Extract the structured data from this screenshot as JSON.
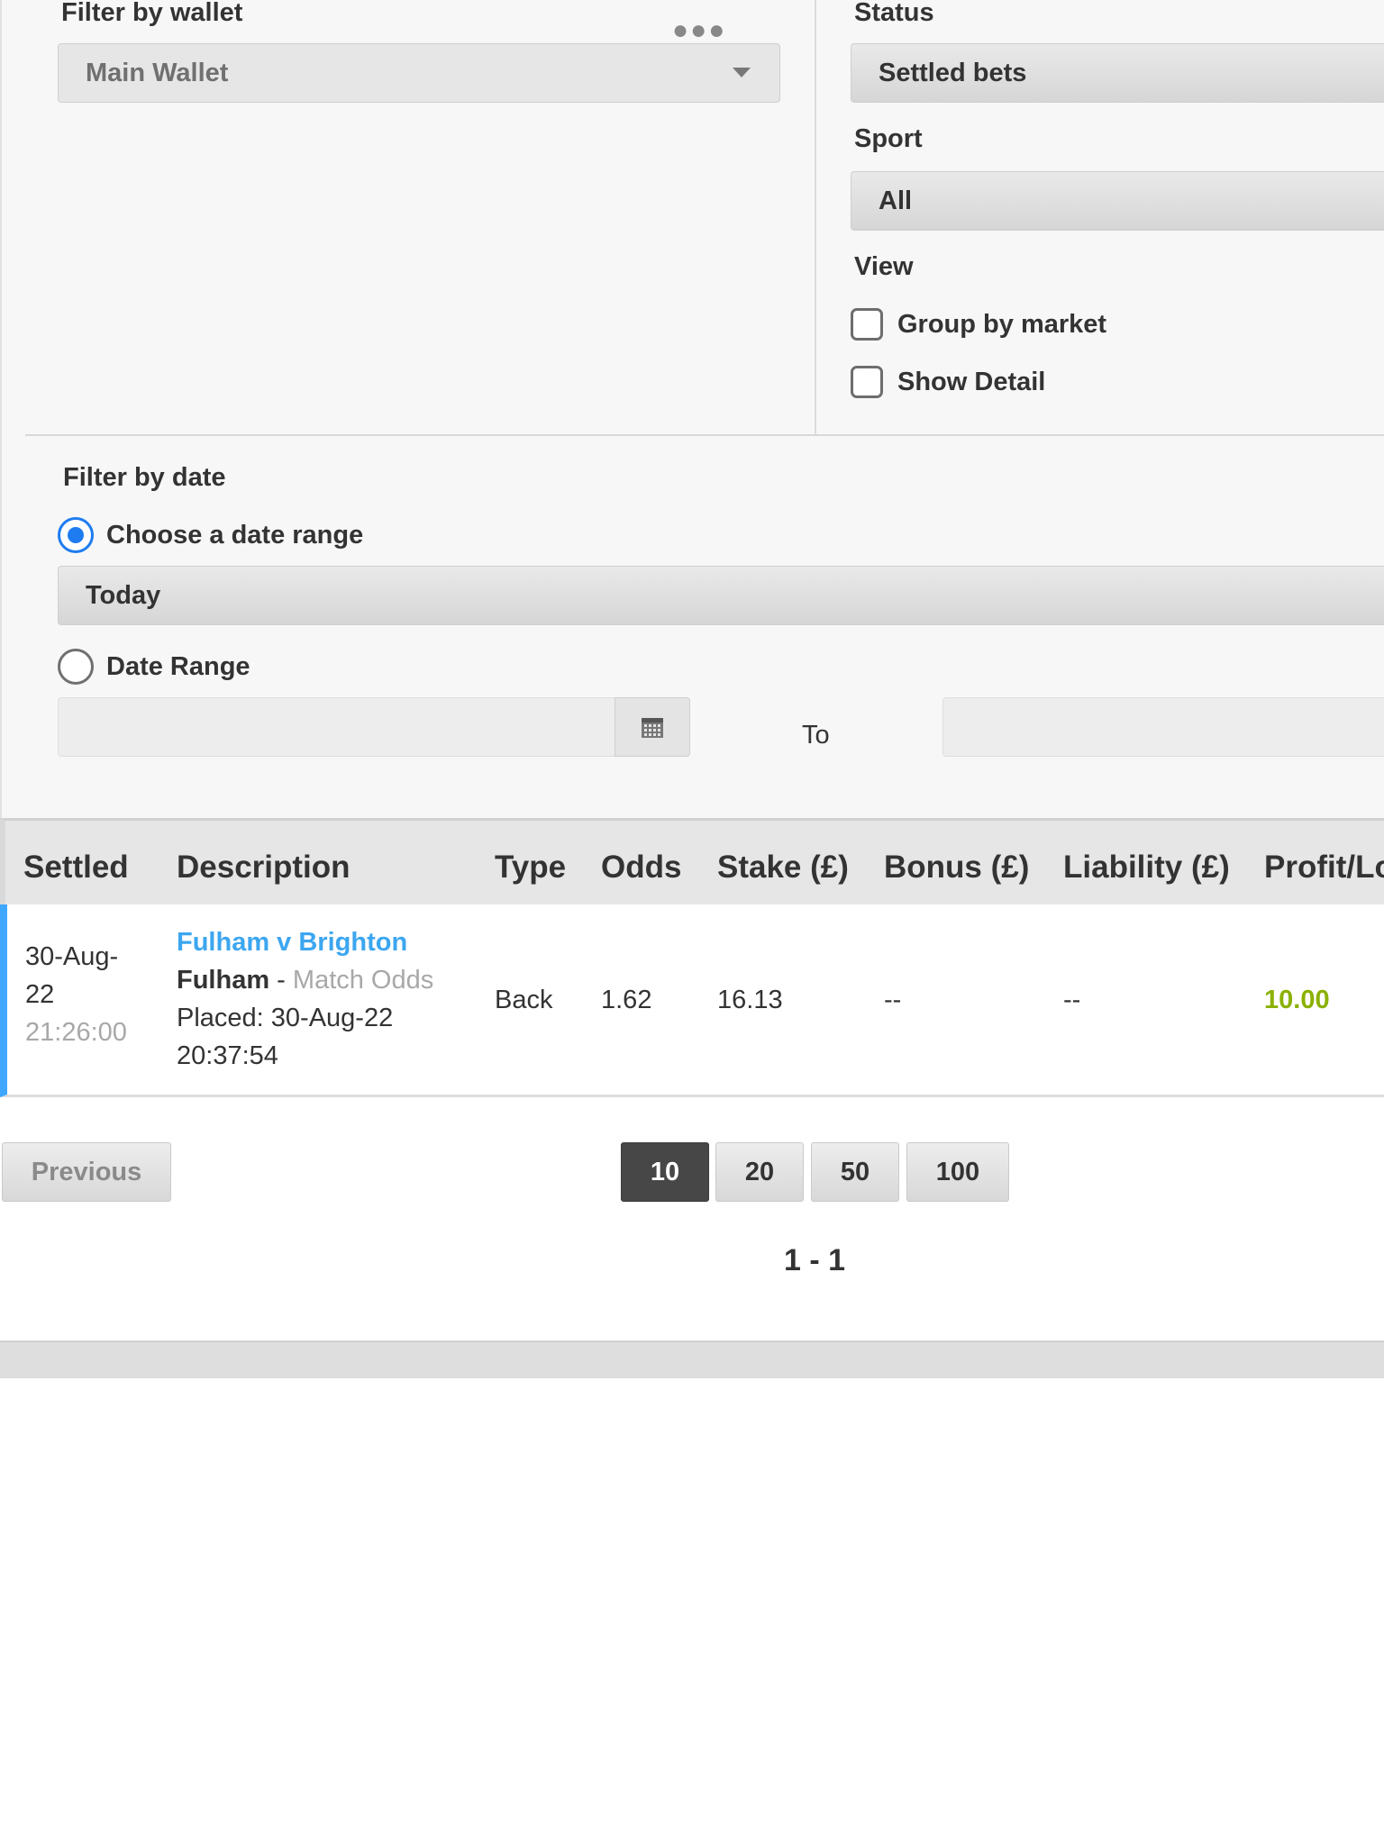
{
  "filters": {
    "wallet": {
      "label": "Filter by wallet",
      "value": "Main Wallet"
    },
    "status": {
      "label": "Status",
      "value": "Settled bets"
    },
    "sport": {
      "label": "Sport",
      "value": "All"
    },
    "view": {
      "label": "View",
      "group_by_market": "Group by market",
      "show_detail": "Show Detail"
    },
    "date": {
      "label": "Filter by date",
      "choose_range": "Choose a date range",
      "range_value": "Today",
      "date_range": "Date Range",
      "to": "To",
      "from_value": "",
      "to_value": ""
    }
  },
  "table": {
    "headers": [
      "Settled",
      "Description",
      "Type",
      "Odds",
      "Stake (£)",
      "Bonus (£)",
      "Liability (£)",
      "Profit/Lo"
    ],
    "rows": [
      {
        "settled_date_1": "30-Aug-",
        "settled_date_2": "22",
        "settled_time": "21:26:00",
        "event": "Fulham v Brighton",
        "selection": "Fulham",
        "separator": " - ",
        "market": "Match Odds",
        "placed_1": "Placed: 30-Aug-22",
        "placed_2": "20:37:54",
        "type": "Back",
        "odds": "1.62",
        "stake": "16.13",
        "bonus": "--",
        "liability": "--",
        "profit": "10.00"
      }
    ]
  },
  "pagination": {
    "previous": "Previous",
    "sizes": [
      "10",
      "20",
      "50",
      "100"
    ],
    "active_size": "10",
    "range": "1 - 1"
  },
  "colors": {
    "accent_blue": "#1e7cf0",
    "link_blue": "#3ca6f0",
    "profit_green": "#8bb100"
  }
}
